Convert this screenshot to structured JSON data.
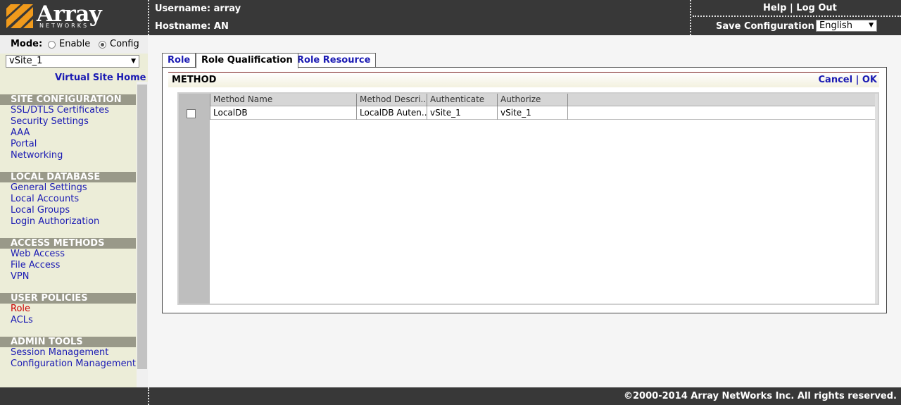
{
  "logo": {
    "brand": "Array",
    "sub": "NETWORKS"
  },
  "header": {
    "username_label": "Username: array",
    "hostname_label": "Hostname: AN",
    "help": "Help",
    "link_sep": "|",
    "logout": "Log Out",
    "save_config": "Save Configuration |",
    "language": "English"
  },
  "sidebar": {
    "mode_label": "Mode:",
    "mode_enable": "Enable",
    "mode_config": "Config",
    "vsite": "vSite_1",
    "vsite_home": "Virtual Site Home",
    "sections": [
      {
        "title": "SITE CONFIGURATION",
        "items": [
          "SSL/DTLS Certificates",
          "Security Settings",
          "AAA",
          "Portal",
          "Networking"
        ]
      },
      {
        "title": "LOCAL DATABASE",
        "items": [
          "General Settings",
          "Local Accounts",
          "Local Groups",
          "Login Authorization"
        ]
      },
      {
        "title": "ACCESS METHODS",
        "items": [
          "Web Access",
          "File Access",
          "VPN"
        ]
      },
      {
        "title": "USER POLICIES",
        "items": [
          "Role",
          "ACLs"
        ]
      },
      {
        "title": "ADMIN TOOLS",
        "items": [
          "Session Management",
          "Configuration Management"
        ]
      }
    ],
    "active_item": "Role"
  },
  "tabs": [
    "Role",
    "Role Qualification",
    "Role Resource"
  ],
  "active_tab": "Role Qualification",
  "method": {
    "title": "METHOD",
    "cancel": "Cancel",
    "sep": "|",
    "ok": "OK",
    "columns": [
      "Method Name",
      "Method Descri...",
      "Authenticate",
      "Authorize"
    ],
    "rows": [
      {
        "checked": false,
        "cells": [
          "LocalDB",
          "LocalDB Auten...",
          "vSite_1",
          "vSite_1"
        ]
      }
    ]
  },
  "footer": {
    "copyright": "©2000-2014 Array NetWorks Inc. All rights reserved."
  },
  "colors": {
    "header_bg": "#383838",
    "sidebar_bg": "#ecedd8",
    "section_bg": "#999989",
    "link": "#1a1ab3",
    "active_link": "#cc0000",
    "logo_orange": "#f09a1c"
  }
}
